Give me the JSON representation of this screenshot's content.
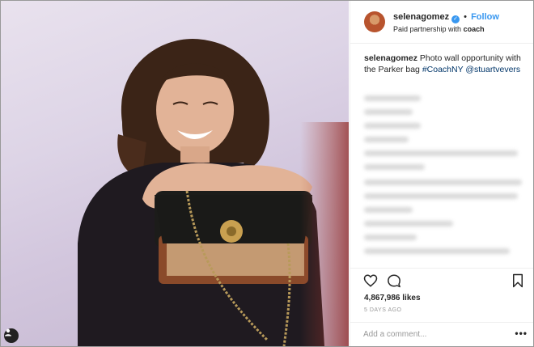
{
  "post": {
    "username": "selenagomez",
    "verified_mark": "✓",
    "dot": "•",
    "follow_label": "Follow",
    "partnership_prefix": "Paid partnership with",
    "partnership_brand": "coach"
  },
  "caption": {
    "username": "selenagomez",
    "text": "Photo wall opportunity with the Parker bag",
    "hashtag": "#CoachNY",
    "mention": "@stuartvevers"
  },
  "footer": {
    "likes": "4,867,986 likes",
    "timestamp": "5 DAYS AGO",
    "comment_placeholder": "Add a comment...",
    "more_label": "•••"
  },
  "icons": [
    "heart-icon",
    "comment-icon",
    "bookmark-icon",
    "user-tag-icon",
    "verified-badge-icon"
  ],
  "colors": {
    "link": "#3897f0",
    "hashtag": "#003569",
    "text": "#262626",
    "muted": "#999999"
  }
}
